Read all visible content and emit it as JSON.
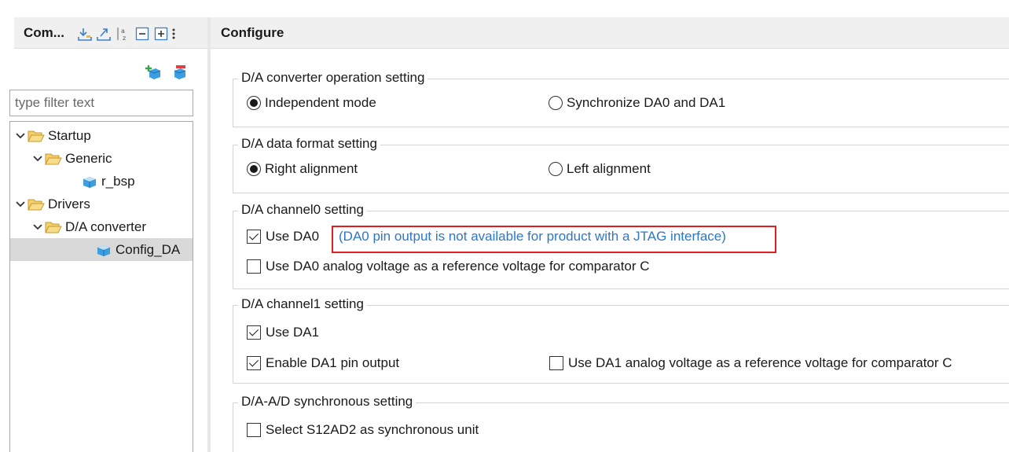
{
  "left_panel": {
    "title": "Com...",
    "toolbar_icons": [
      "import-icon",
      "export-icon",
      "sort-az-icon",
      "collapse-all-icon",
      "expand-all-icon",
      "more-icon"
    ],
    "action_icons": [
      "add-component-icon",
      "remove-component-icon"
    ],
    "filter": {
      "placeholder": "type filter text",
      "value": ""
    },
    "tree": [
      {
        "label": "Startup",
        "kind": "folder",
        "expanded": true
      },
      {
        "label": "Generic",
        "kind": "folder",
        "expanded": true
      },
      {
        "label": "r_bsp",
        "kind": "component"
      },
      {
        "label": "Drivers",
        "kind": "folder",
        "expanded": true
      },
      {
        "label": "D/A converter",
        "kind": "folder",
        "expanded": true
      },
      {
        "label": "Config_DA",
        "kind": "component",
        "selected": true
      }
    ]
  },
  "right_panel": {
    "title": "Configure",
    "groups": {
      "operation": {
        "title": "D/A converter operation setting",
        "opt1": "Independent mode",
        "opt2": "Synchronize DA0 and DA1",
        "selected": "opt1"
      },
      "format": {
        "title": "D/A data format setting",
        "opt1": "Right alignment",
        "opt2": "Left alignment",
        "selected": "opt1"
      },
      "channel0": {
        "title": "D/A channel0 setting",
        "use": "Use DA0",
        "use_checked": true,
        "note": "(DA0 pin output is not available for product with a JTAG interface)",
        "ref": "Use DA0 analog voltage as a reference voltage for comparator C",
        "ref_checked": false
      },
      "channel1": {
        "title": "D/A channel1 setting",
        "use": "Use DA1",
        "use_checked": true,
        "enable": "Enable DA1 pin output",
        "enable_checked": true,
        "ref": "Use DA1 analog voltage as a reference voltage for comparator C",
        "ref_checked": false
      },
      "sync": {
        "title": "D/A-A/D synchronous setting",
        "unit": "Select S12AD2 as synchronous unit",
        "unit_checked": false
      }
    }
  },
  "colors": {
    "header_bg": "#f0f0f0",
    "selection": "#d9d9d9",
    "note_text": "#2a78c8",
    "highlight": "#e02020",
    "folder": "#e8b84a"
  }
}
